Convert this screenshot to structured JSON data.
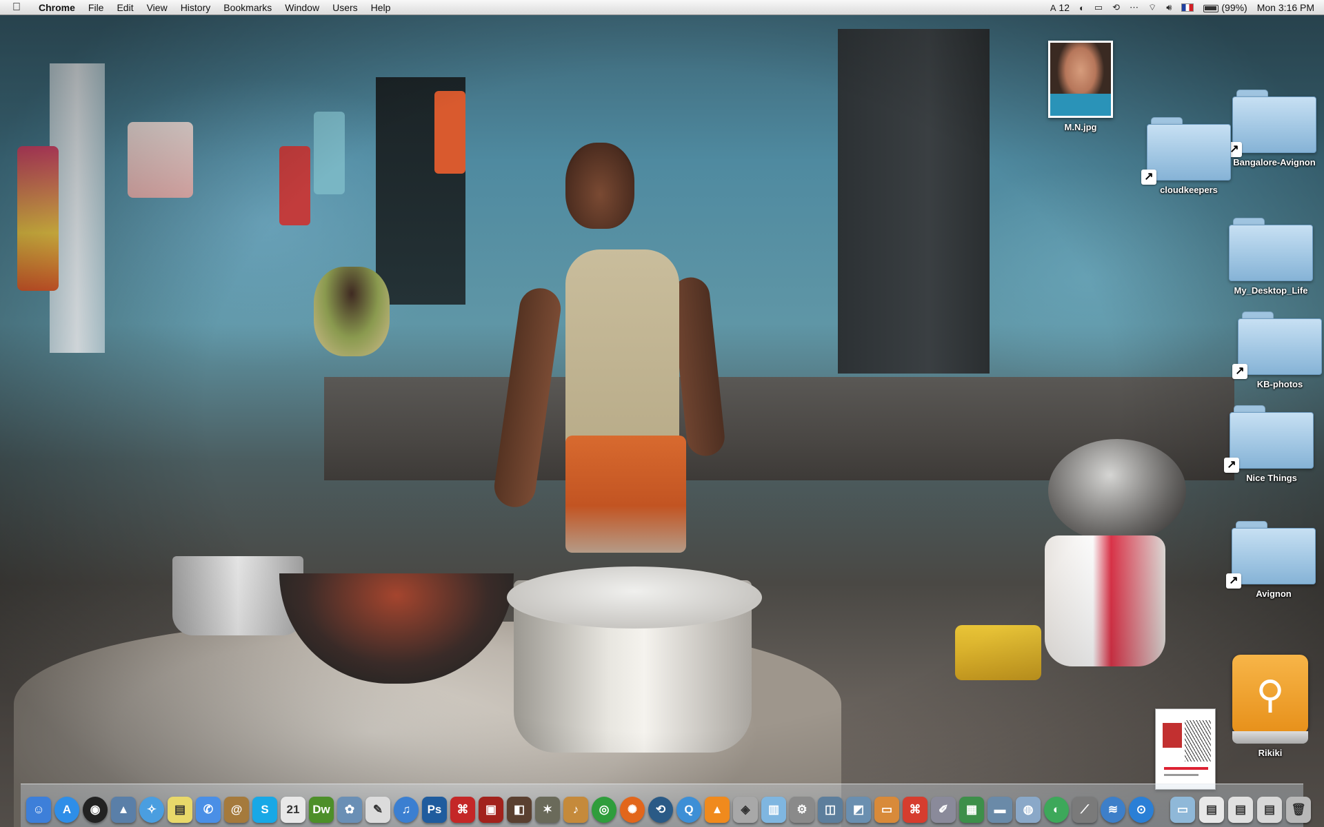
{
  "menubar": {
    "app_name": "Chrome",
    "menus": [
      "File",
      "Edit",
      "View",
      "History",
      "Bookmarks",
      "Window",
      "Users",
      "Help"
    ],
    "status": {
      "notification_count": "12",
      "battery": "(99%)",
      "clock": "Mon 3:16 PM"
    }
  },
  "desktop_icons": {
    "mn_photo": "M.N.jpg",
    "bangalore": "Bangalore-Avignon",
    "cloudkeepers": "cloudkeepers",
    "my_desktop_life": "My_Desktop_Life",
    "kb_photos": "KB-photos",
    "nice_things": "Nice Things",
    "avignon": "Avignon",
    "rikiki": "Rikiki"
  },
  "dock": {
    "apps": [
      {
        "icon": "finder-icon",
        "glyph": "☺",
        "color": "#3d7fd9"
      },
      {
        "icon": "app-store-icon",
        "glyph": "A",
        "color": "#2e8ee8"
      },
      {
        "icon": "dashboard-icon",
        "glyph": "◉",
        "color": "#222222"
      },
      {
        "icon": "preview-icon",
        "glyph": "▲",
        "color": "#5a7fa8"
      },
      {
        "icon": "safari-icon",
        "glyph": "✧",
        "color": "#4a9ee0"
      },
      {
        "icon": "stickies-icon",
        "glyph": "▤",
        "color": "#e8d86a"
      },
      {
        "icon": "ichat-icon",
        "glyph": "✆",
        "color": "#4a8fe6"
      },
      {
        "icon": "address-book-icon",
        "glyph": "@",
        "color": "#a57a3c"
      },
      {
        "icon": "skype-icon",
        "glyph": "S",
        "color": "#18a8e6"
      },
      {
        "icon": "ical-icon",
        "glyph": "21",
        "color": "#e8e8e8"
      },
      {
        "icon": "dreamweaver-icon",
        "glyph": "Dw",
        "color": "#4d8f29"
      },
      {
        "icon": "iphoto-icon",
        "glyph": "✿",
        "color": "#6a8fb5"
      },
      {
        "icon": "textedit-icon",
        "glyph": "✎",
        "color": "#dcdcdc"
      },
      {
        "icon": "itunes-icon",
        "glyph": "♫",
        "color": "#3b7fd1"
      },
      {
        "icon": "photoshop-icon",
        "glyph": "Ps",
        "color": "#1f5c9e"
      },
      {
        "icon": "acrobat-icon",
        "glyph": "⌘",
        "color": "#c42727"
      },
      {
        "icon": "photobooth-icon",
        "glyph": "▣",
        "color": "#a2221c"
      },
      {
        "icon": "image-capture-icon",
        "glyph": "◧",
        "color": "#5a4030"
      },
      {
        "icon": "screenshot-icon",
        "glyph": "✶",
        "color": "#6a6a5a"
      },
      {
        "icon": "garageband-icon",
        "glyph": "♪",
        "color": "#c58a3b"
      },
      {
        "icon": "chrome-icon",
        "glyph": "◎",
        "color": "#2f9d3c"
      },
      {
        "icon": "firefox-icon",
        "glyph": "✺",
        "color": "#e2661b"
      },
      {
        "icon": "time-machine-icon",
        "glyph": "⟲",
        "color": "#2a5a86"
      },
      {
        "icon": "quicktime-icon",
        "glyph": "Q",
        "color": "#3d8fd6"
      },
      {
        "icon": "vlc-icon",
        "glyph": "▲",
        "color": "#f08a1d"
      },
      {
        "icon": "dvd-player-icon",
        "glyph": "◈",
        "color": "#a8a8a8"
      },
      {
        "icon": "preview-doc-icon",
        "glyph": "▥",
        "color": "#7fb6e0"
      },
      {
        "icon": "system-preferences-icon",
        "glyph": "⚙",
        "color": "#8a8a8a"
      },
      {
        "icon": "digital-color-meter-icon",
        "glyph": "◫",
        "color": "#5d7e9c"
      },
      {
        "icon": "keynote-icon",
        "glyph": "◩",
        "color": "#6a8fb0"
      },
      {
        "icon": "presentation-icon",
        "glyph": "▭",
        "color": "#d88a3a"
      },
      {
        "icon": "adobe-reader-icon",
        "glyph": "⌘",
        "color": "#d63d2e"
      },
      {
        "icon": "script-editor-icon",
        "glyph": "✐",
        "color": "#8a8a9a"
      },
      {
        "icon": "numbers-icon",
        "glyph": "▦",
        "color": "#3d8f4a"
      },
      {
        "icon": "monitor-icon",
        "glyph": "▬",
        "color": "#6a8aa8"
      },
      {
        "icon": "network-utility-icon",
        "glyph": "◍",
        "color": "#8aa8c8"
      },
      {
        "icon": "cyberduck-icon",
        "glyph": "◐",
        "color": "#3da85a"
      },
      {
        "icon": "grapher-icon",
        "glyph": "⟋",
        "color": "#7a7a7a"
      },
      {
        "icon": "migration-icon",
        "glyph": "≋",
        "color": "#3d7fc9"
      },
      {
        "icon": "spotlight-icon",
        "glyph": "⊙",
        "color": "#2a7fd6"
      }
    ],
    "stacks": [
      {
        "icon": "applications-stack-icon",
        "glyph": "▭",
        "color": "#8fb8d8"
      },
      {
        "icon": "documents-stack-icon",
        "glyph": "▤",
        "color": "#e8e8e8"
      },
      {
        "icon": "downloads-stack-icon",
        "glyph": "▤",
        "color": "#e0e0e0"
      },
      {
        "icon": "file-stack-icon",
        "glyph": "▤",
        "color": "#d8d8d8"
      },
      {
        "icon": "trash-icon",
        "glyph": "🗑",
        "color": "#b8b8b8"
      }
    ]
  }
}
